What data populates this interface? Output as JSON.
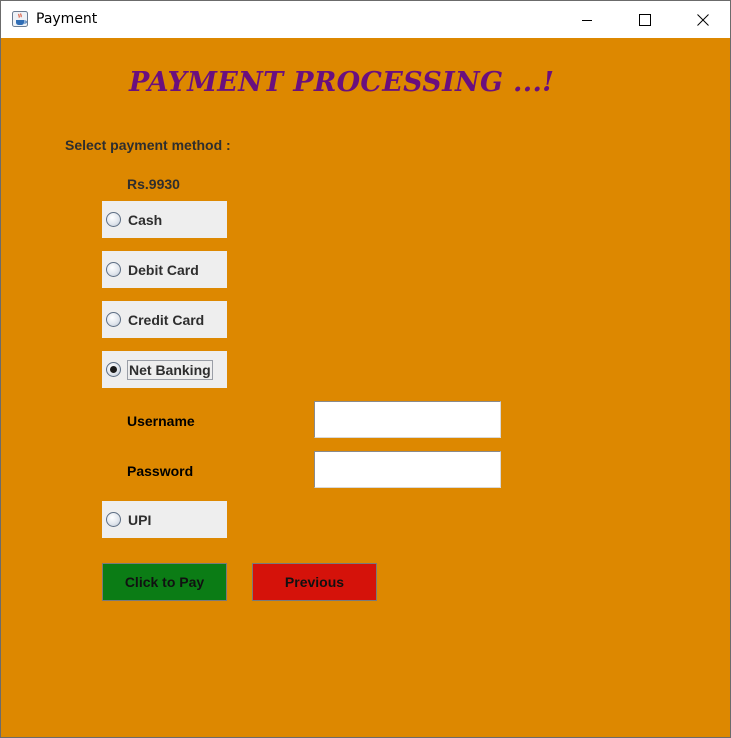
{
  "window": {
    "title": "Payment",
    "app_icon": "java-cup-icon",
    "controls": [
      "minimize-icon",
      "maximize-icon",
      "close-icon"
    ]
  },
  "colors": {
    "background": "#dd8800",
    "heading": "#6a0f7e",
    "pay_button": "#0b7c15",
    "previous_button": "#d5120a",
    "radio_panel": "#eeeeee"
  },
  "heading": "PAYMENT PROCESSING ...!",
  "select_label": "Select payment method :",
  "amount": "Rs.9930",
  "methods": [
    {
      "label": "Cash",
      "selected": false
    },
    {
      "label": "Debit Card",
      "selected": false
    },
    {
      "label": "Credit Card",
      "selected": false
    },
    {
      "label": "Net Banking",
      "selected": true
    },
    {
      "label": "UPI",
      "selected": false
    }
  ],
  "net_banking": {
    "username_label": "Username",
    "username_value": "",
    "password_label": "Password",
    "password_value": ""
  },
  "buttons": {
    "pay": "Click to Pay",
    "previous": "Previous"
  }
}
